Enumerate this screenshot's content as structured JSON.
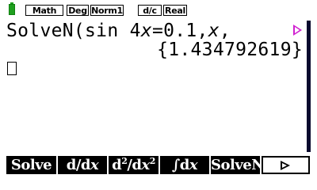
{
  "status_bar": {
    "battery_icon": "battery-icon",
    "battery_color": "#1fa01f",
    "badges": {
      "input_mode": "Math",
      "angle": "Deg",
      "display": "Norm1",
      "fraction": "d/c",
      "complex": "Real"
    }
  },
  "calc": {
    "input": {
      "prefix": "SolveN(sin 4",
      "var1": "x",
      "middle": "=0.1,",
      "var2": "x",
      "suffix": ","
    },
    "result": "{1.434792619}",
    "more_indicator_icon": "triangle-right-icon",
    "more_indicator_color": "#d020d0"
  },
  "function_keys": {
    "f1": "Solve",
    "f2": {
      "a": "d/d",
      "b": "x"
    },
    "f3": {
      "a": "d",
      "sup1": "2",
      "b": "/d",
      "c": "x",
      "sup2": "2"
    },
    "f4": {
      "a": "∫d",
      "b": "x"
    },
    "f5": "SolveN",
    "f6_icon": "triangle-right-icon"
  },
  "colors": {
    "background": "#ffffff",
    "key_bar": "#000000",
    "scrollbar": "#0a0a2e"
  }
}
